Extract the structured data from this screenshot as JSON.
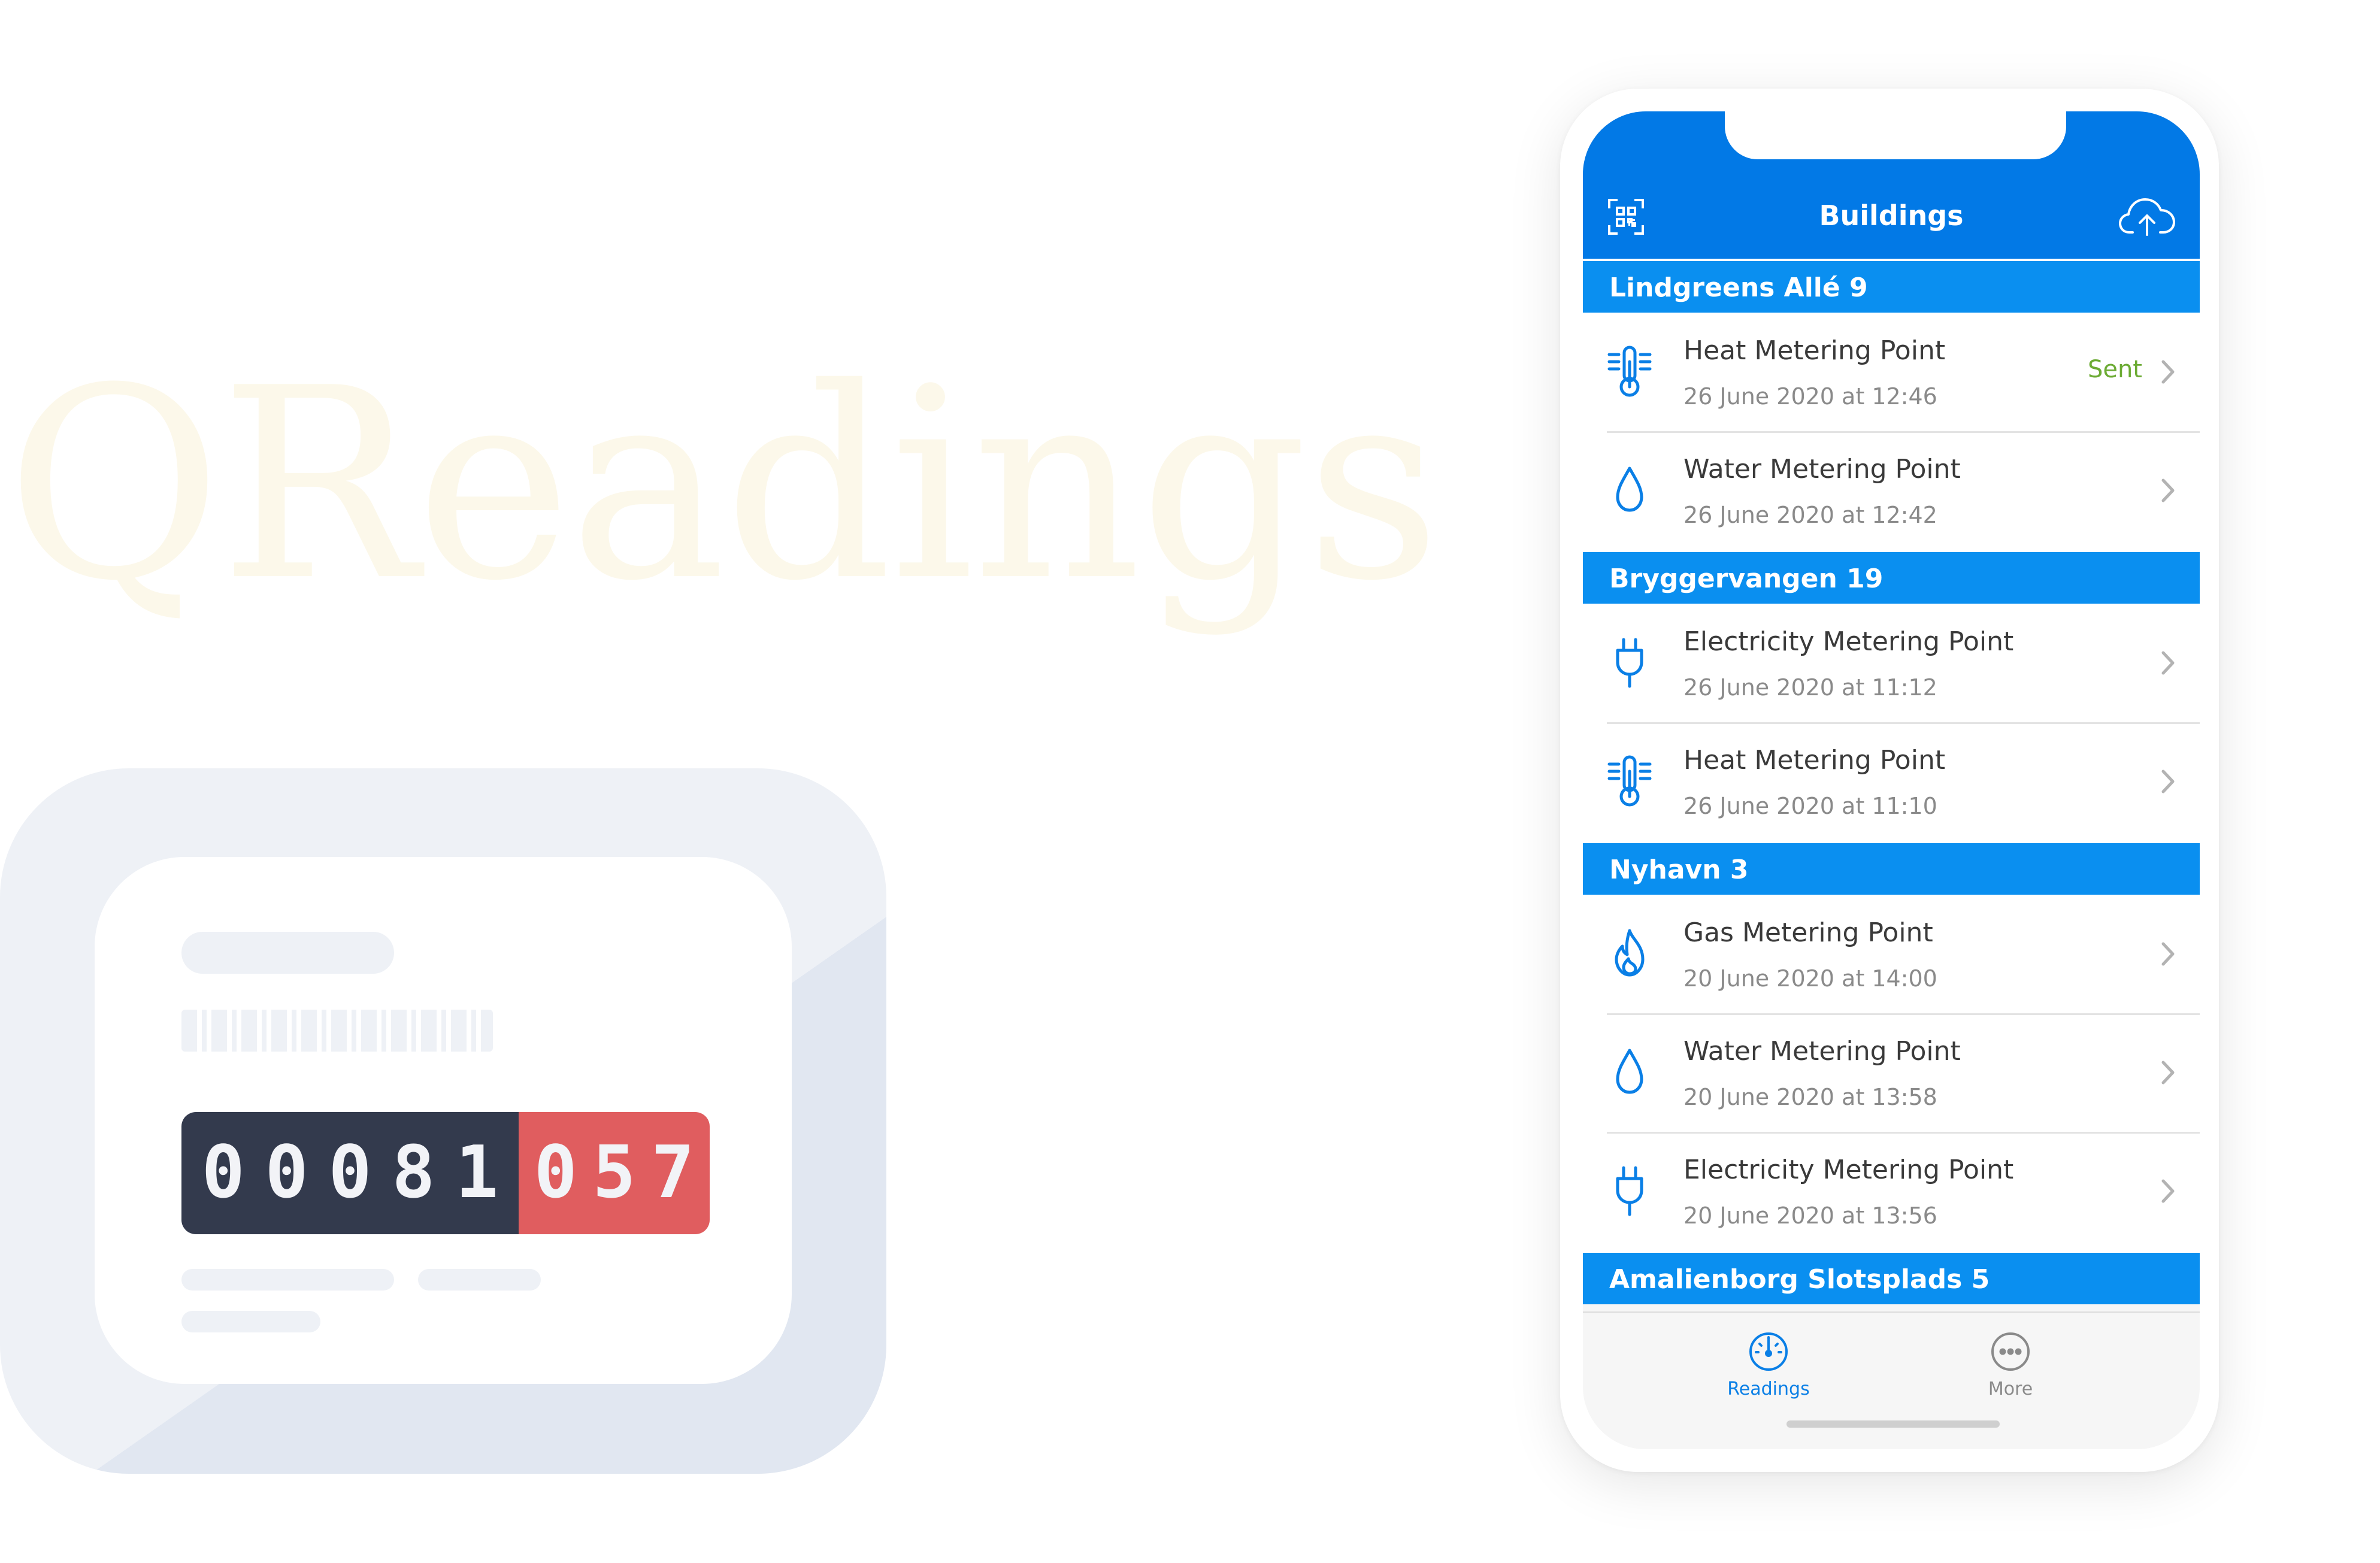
{
  "brand": {
    "name": "QReadings"
  },
  "meter": {
    "digits_main": [
      "0",
      "0",
      "0",
      "8",
      "1"
    ],
    "digits_decimal": [
      "0",
      "5",
      "7"
    ]
  },
  "colors": {
    "accent": "#0279e6",
    "section": "#0a8ff0",
    "sent": "#6cab34",
    "meter_dark": "#333a4d",
    "meter_red": "#e05d5f"
  },
  "app": {
    "nav": {
      "title": "Buildings",
      "left_icon": "qr-code-scan-icon",
      "right_icon": "cloud-upload-icon"
    },
    "sections": [
      {
        "name": "Lindgreens Allé 9",
        "items": [
          {
            "title": "Heat Metering Point",
            "date": "26 June 2020 at 12:46",
            "icon": "thermometer-icon",
            "status": "Sent"
          },
          {
            "title": "Water Metering Point",
            "date": "26 June 2020 at 12:42",
            "icon": "water-drop-icon",
            "status": ""
          }
        ]
      },
      {
        "name": "Bryggervangen 19",
        "items": [
          {
            "title": "Electricity Metering Point",
            "date": "26 June 2020 at 11:12",
            "icon": "plug-icon",
            "status": ""
          },
          {
            "title": "Heat Metering Point",
            "date": "26 June 2020 at 11:10",
            "icon": "thermometer-icon",
            "status": ""
          }
        ]
      },
      {
        "name": "Nyhavn 3",
        "items": [
          {
            "title": "Gas Metering Point",
            "date": "20 June 2020 at 14:00",
            "icon": "flame-icon",
            "status": ""
          },
          {
            "title": "Water Metering Point",
            "date": "20 June 2020 at 13:58",
            "icon": "water-drop-icon",
            "status": ""
          },
          {
            "title": "Electricity Metering Point",
            "date": "20 June 2020 at 13:56",
            "icon": "plug-icon",
            "status": ""
          }
        ]
      },
      {
        "name": "Amalienborg Slotsplads 5",
        "items": []
      }
    ],
    "tabs": [
      {
        "label": "Readings",
        "icon": "gauge-icon",
        "active": true
      },
      {
        "label": "More",
        "icon": "more-dots-icon",
        "active": false
      }
    ]
  }
}
